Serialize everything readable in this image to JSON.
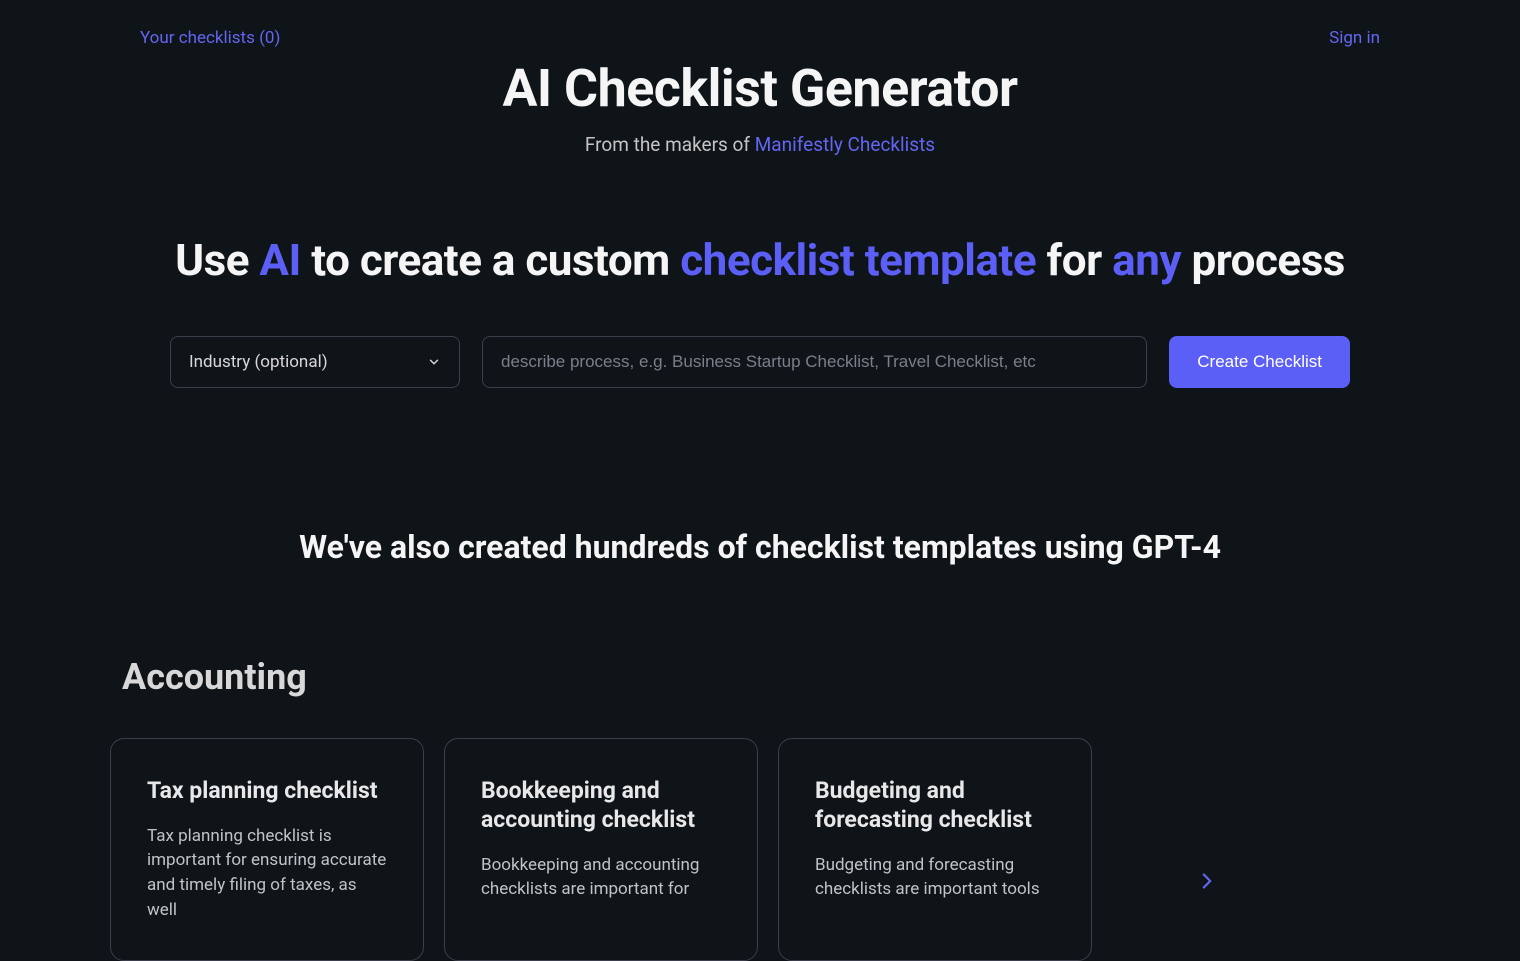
{
  "topbar": {
    "yourChecklists": "Your checklists (0)",
    "signIn": "Sign in"
  },
  "hero": {
    "title": "AI Checklist Generator",
    "subtitlePrefix": "From the makers of ",
    "subtitleLink": "Manifestly Checklists"
  },
  "headline": {
    "p1": "Use ",
    "a1": "AI",
    "p2": " to create a custom ",
    "a2": "checklist template",
    "p3": " for ",
    "a3": "any",
    "p4": " process"
  },
  "form": {
    "industryLabel": "Industry (optional)",
    "processPlaceholder": "describe process, e.g. Business Startup Checklist, Travel Checklist, etc",
    "createLabel": "Create Checklist"
  },
  "sectionTitle": "We've also created hundreds of checklist templates using GPT-4",
  "category": {
    "name": "Accounting",
    "cards": [
      {
        "title": "Tax planning checklist",
        "body": "Tax planning checklist is important for ensuring accurate and timely filing of taxes, as well"
      },
      {
        "title": "Bookkeeping and accounting checklist",
        "body": "Bookkeeping and accounting checklists are important for"
      },
      {
        "title": "Budgeting and forecasting checklist",
        "body": "Budgeting and forecasting checklists are important tools"
      }
    ]
  }
}
